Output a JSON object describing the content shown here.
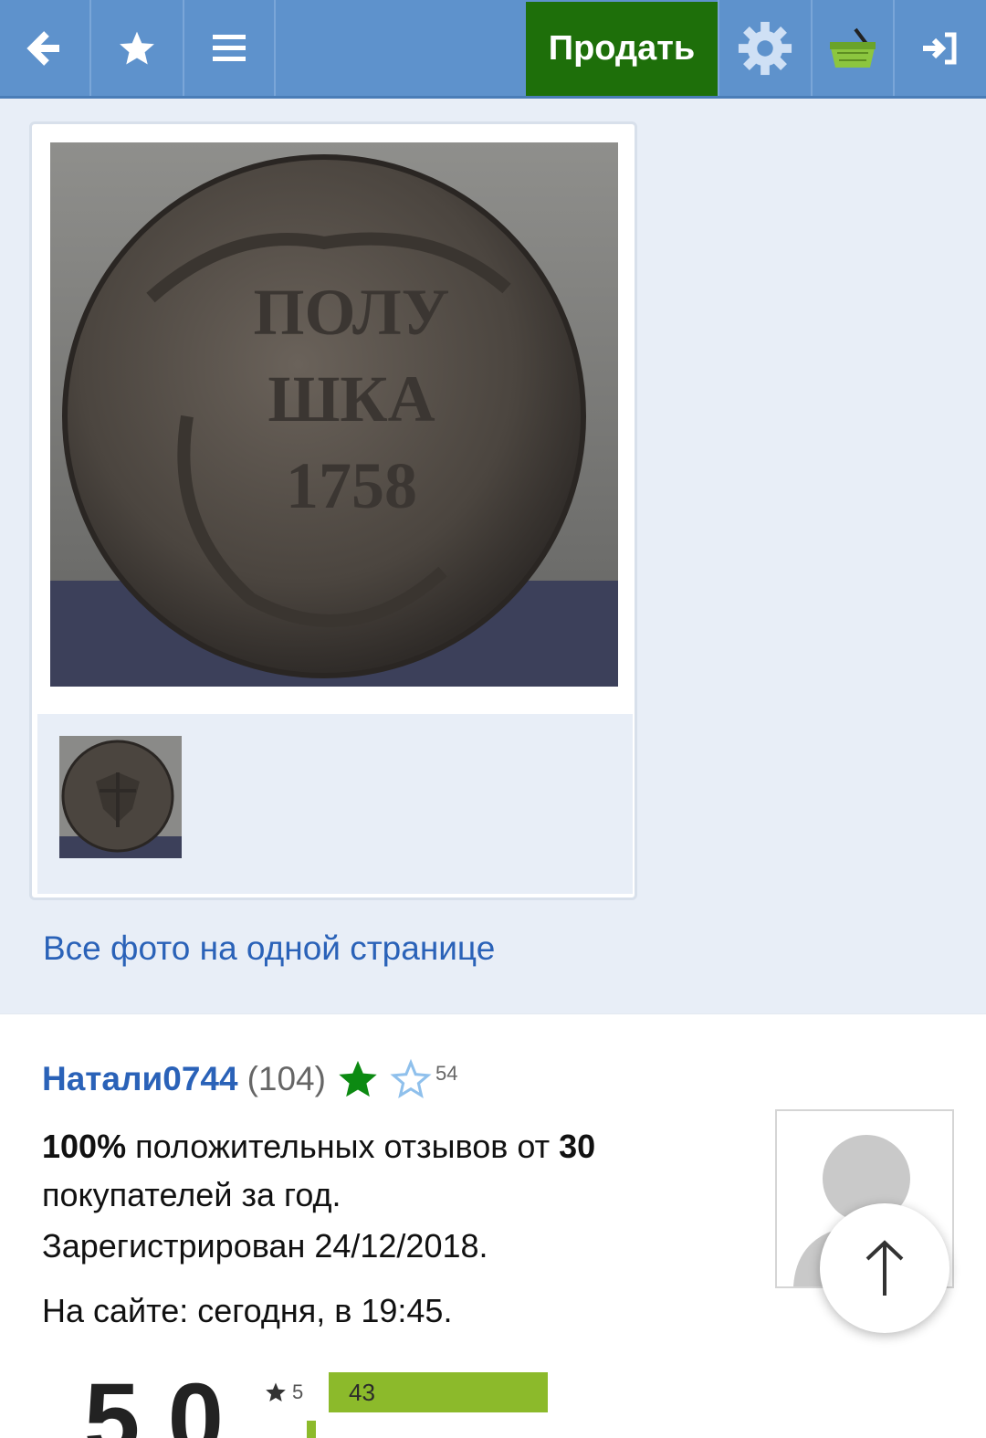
{
  "topbar": {
    "back_icon": "arrow-left-icon",
    "favorites_icon": "star-icon",
    "menu_icon": "hamburger-icon",
    "sell_label": "Продать",
    "settings_icon": "gear-icon",
    "basket_icon": "basket-icon",
    "login_icon": "login-icon"
  },
  "gallery": {
    "main_photo": "coin-reverse-photo",
    "thumbnail": "coin-obverse-thumbnail",
    "all_photos_link": "Все фото на одной странице"
  },
  "seller": {
    "name": "Натали0744",
    "count": "(104)",
    "star_count": "54",
    "feedback_percent": "100%",
    "feedback_text_1": " положительных отзывов от ",
    "feedback_buyers": "30",
    "feedback_text_2": " покупателей за год.",
    "registered": "Зарегистрирован 24/12/2018.",
    "online": "На сайте: сегодня, в 19:45."
  },
  "rating": {
    "score": "5.0",
    "rows": [
      {
        "stars": "5",
        "count": "43"
      }
    ]
  },
  "colors": {
    "nav_bg": "#5e92cc",
    "sell_bg": "#1e6f0a",
    "link": "#2a62b8",
    "bar": "#8cba2b"
  }
}
